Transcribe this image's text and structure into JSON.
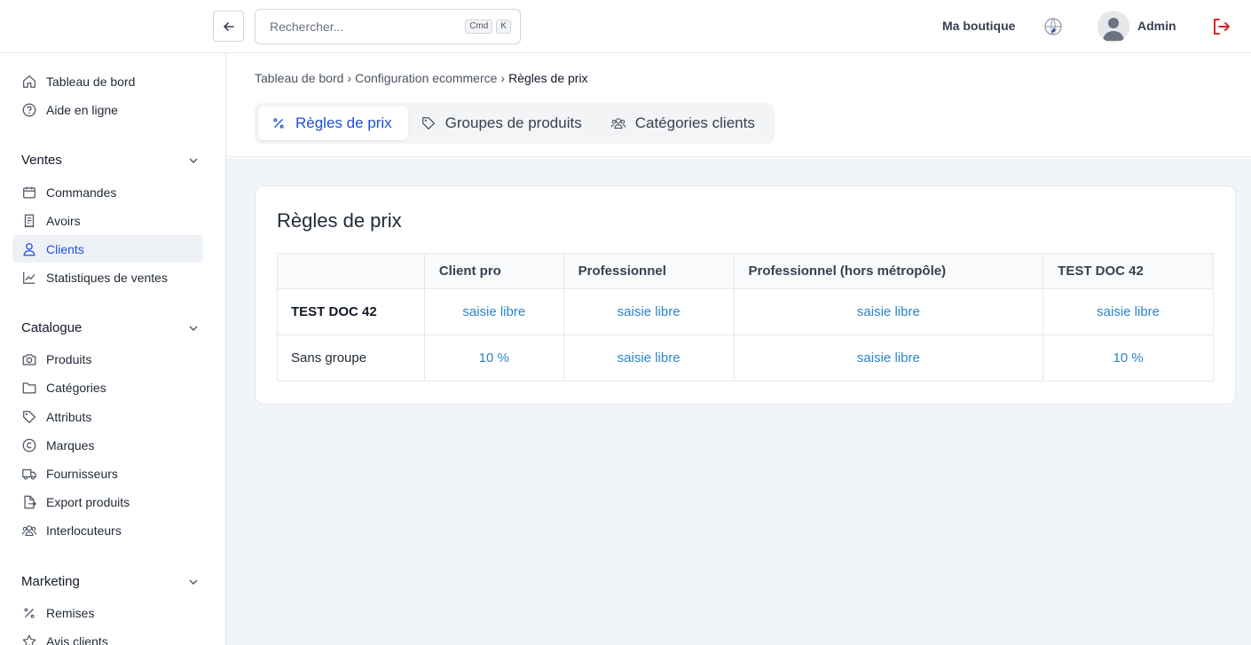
{
  "header": {
    "search_placeholder": "Rechercher...",
    "kbd_cmd": "Cmd",
    "kbd_k": "K",
    "shop_name": "Ma boutique",
    "user_name": "Admin"
  },
  "sidebar": {
    "top_items": [
      {
        "label": "Tableau de bord",
        "icon": "home-icon"
      },
      {
        "label": "Aide en ligne",
        "icon": "help-icon"
      }
    ],
    "sections": [
      {
        "title": "Ventes",
        "items": [
          {
            "label": "Commandes",
            "icon": "calendar-icon"
          },
          {
            "label": "Avoirs",
            "icon": "receipt-icon"
          },
          {
            "label": "Clients",
            "icon": "user-icon",
            "active": true
          },
          {
            "label": "Statistiques de ventes",
            "icon": "chart-icon"
          }
        ]
      },
      {
        "title": "Catalogue",
        "items": [
          {
            "label": "Produits",
            "icon": "camera-icon"
          },
          {
            "label": "Catégories",
            "icon": "folder-icon"
          },
          {
            "label": "Attributs",
            "icon": "tag-icon"
          },
          {
            "label": "Marques",
            "icon": "copyright-icon"
          },
          {
            "label": "Fournisseurs",
            "icon": "truck-icon"
          },
          {
            "label": "Export produits",
            "icon": "export-icon"
          },
          {
            "label": "Interlocuteurs",
            "icon": "users-icon"
          }
        ]
      },
      {
        "title": "Marketing",
        "items": [
          {
            "label": "Remises",
            "icon": "percent-icon"
          },
          {
            "label": "Avis clients",
            "icon": "star-icon"
          }
        ]
      }
    ]
  },
  "breadcrumb": [
    "Tableau de bord",
    "Configuration ecommerce",
    "Règles de prix"
  ],
  "breadcrumb_sep": "›",
  "tabs": [
    {
      "label": "Règles de prix",
      "icon": "percent-icon",
      "active": true
    },
    {
      "label": "Groupes de produits",
      "icon": "tag-icon"
    },
    {
      "label": "Catégories clients",
      "icon": "users-icon"
    }
  ],
  "card": {
    "title": "Règles de prix",
    "columns": [
      "",
      "Client pro",
      "Professionnel",
      "Professionnel (hors métropôle)",
      "TEST DOC 42"
    ],
    "rows": [
      {
        "label": "TEST DOC 42",
        "bold": true,
        "cells": [
          "saisie libre",
          "saisie libre",
          "saisie libre",
          "saisie libre"
        ]
      },
      {
        "label": "Sans groupe",
        "bold": false,
        "cells": [
          "10 %",
          "saisie libre",
          "saisie libre",
          "10 %"
        ]
      }
    ]
  },
  "colors": {
    "accent": "#1d4ed8",
    "link": "#2b86c5",
    "logout": "#dc2626",
    "content_bg": "#f1f4f9"
  }
}
